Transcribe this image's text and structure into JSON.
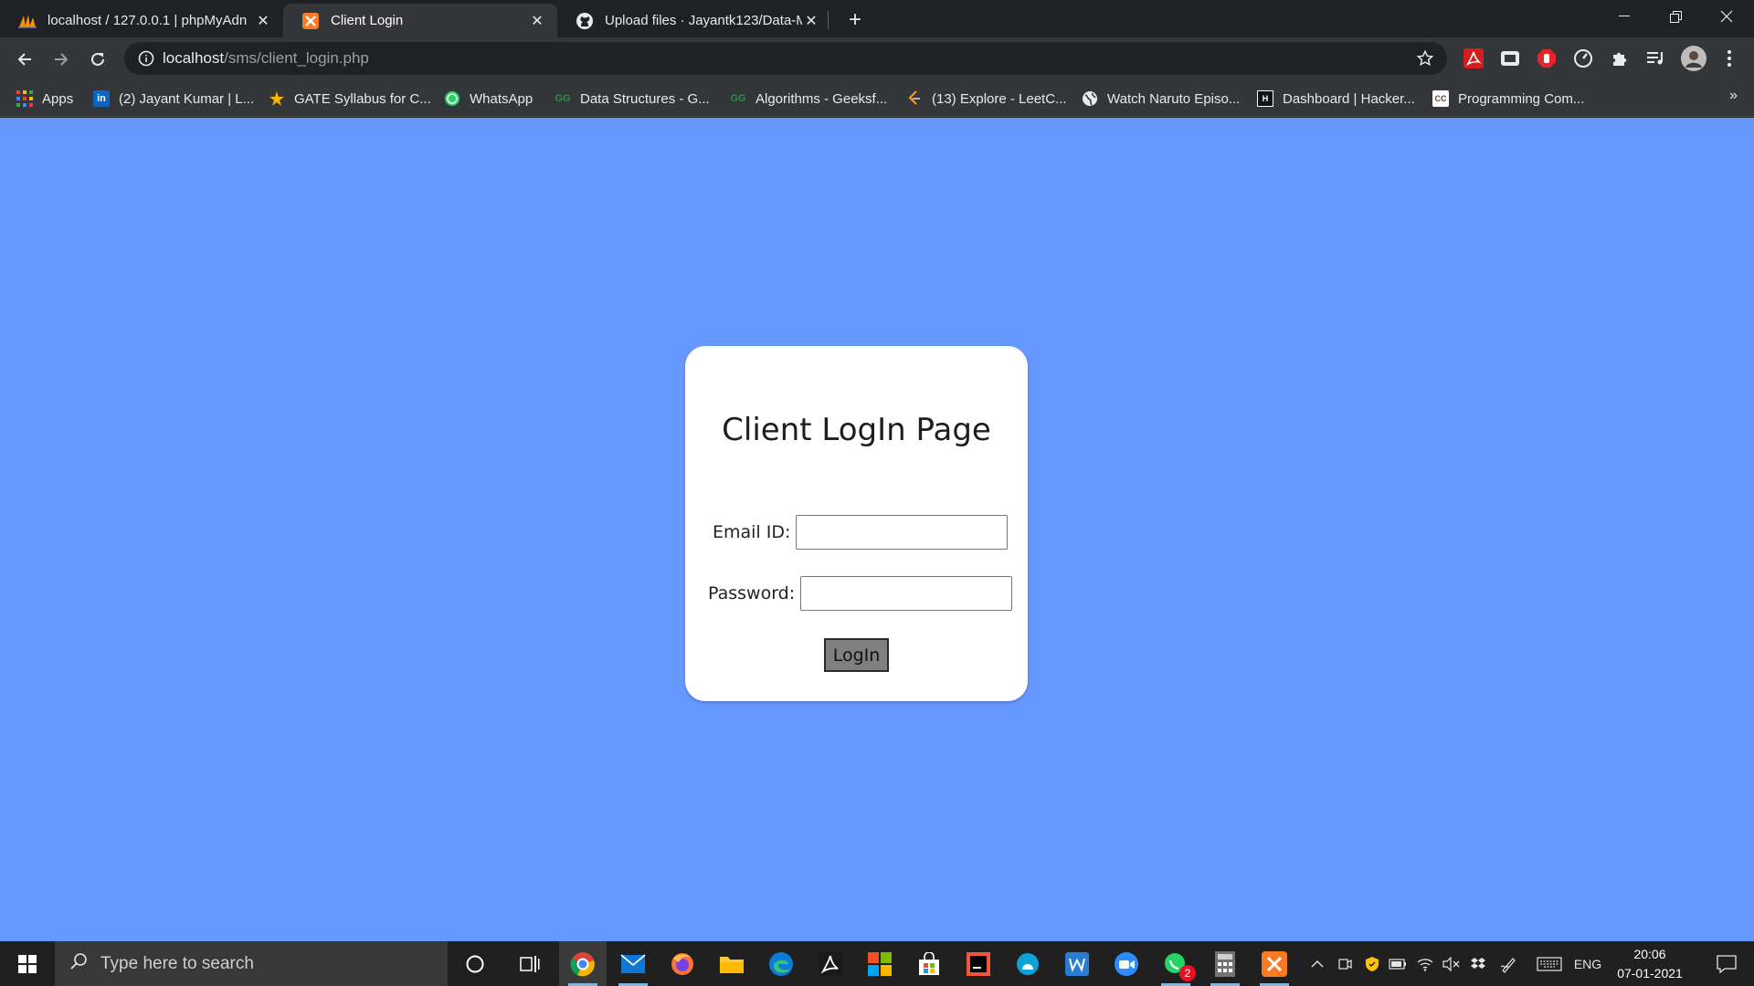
{
  "browser": {
    "tabs": [
      {
        "title": "localhost / 127.0.0.1 | phpMyAdn",
        "icon": "phpmyadmin-icon",
        "active": false
      },
      {
        "title": "Client Login",
        "icon": "xampp-icon",
        "active": true
      },
      {
        "title": "Upload files · Jayantk123/Data-M",
        "icon": "github-icon",
        "active": false
      }
    ],
    "url_host": "localhost",
    "url_path": "/sms/client_login.php",
    "bookmarks": [
      {
        "label": "Apps",
        "icon": "apps-grid-icon"
      },
      {
        "label": "(2) Jayant Kumar | L...",
        "icon": "linkedin-icon"
      },
      {
        "label": "GATE Syllabus for C...",
        "icon": "gate-icon"
      },
      {
        "label": "WhatsApp",
        "icon": "whatsapp-icon"
      },
      {
        "label": "Data Structures - G...",
        "icon": "geeksforgeeks-icon"
      },
      {
        "label": "Algorithms - Geeksf...",
        "icon": "geeksforgeeks-icon"
      },
      {
        "label": "(13) Explore - LeetC...",
        "icon": "leetcode-icon"
      },
      {
        "label": "Watch Naruto Episo...",
        "icon": "globe-icon"
      },
      {
        "label": "Dashboard | Hacker...",
        "icon": "hackerrank-icon"
      },
      {
        "label": "Programming Com...",
        "icon": "codechef-icon"
      }
    ]
  },
  "page": {
    "title": "Client LogIn Page",
    "email_label": "Email ID:",
    "password_label": "Password:",
    "login_button": "LogIn",
    "background_color": "#6699ff"
  },
  "taskbar": {
    "search_placeholder": "Type here to search",
    "whatsapp_badge": "2",
    "language": "ENG",
    "time": "20:06",
    "date": "07-01-2021"
  }
}
